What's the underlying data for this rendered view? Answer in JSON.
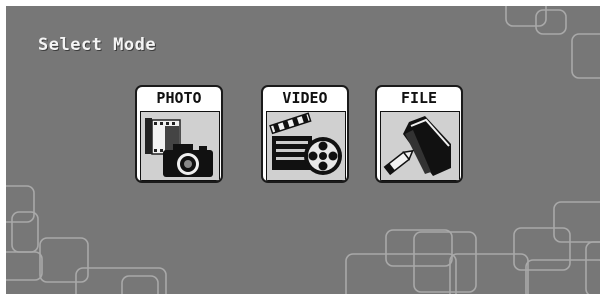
{
  "screen": {
    "title": "Select Mode",
    "background_color": "#777777",
    "decoration_color": "#a9a9a9"
  },
  "modes": [
    {
      "label": "PHOTO",
      "icon": "photo-camera-film-icon"
    },
    {
      "label": "VIDEO",
      "icon": "clapperboard-film-reel-icon"
    },
    {
      "label": "FILE",
      "icon": "folder-pencil-icon"
    }
  ]
}
